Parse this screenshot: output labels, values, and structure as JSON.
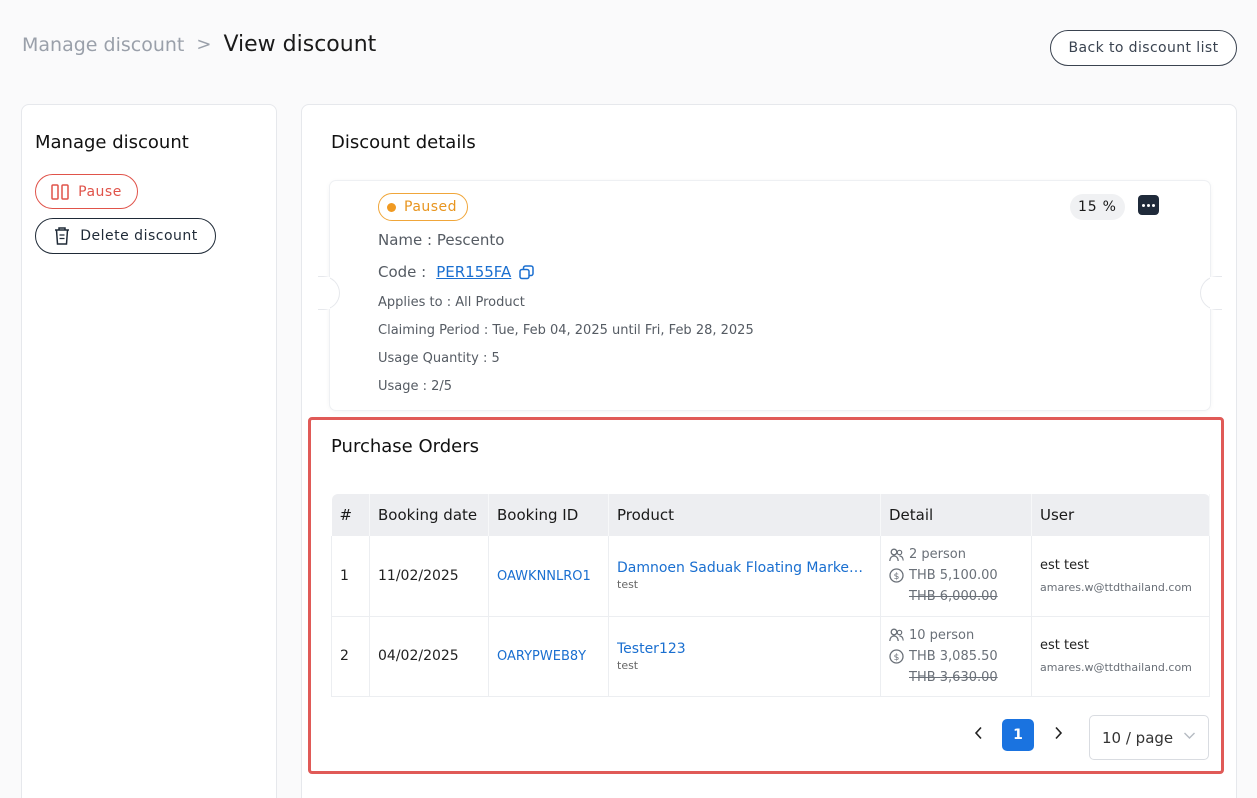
{
  "header": {
    "breadcrumb_parent": "Manage discount",
    "breadcrumb_separator": ">",
    "title": "View discount",
    "back_button": "Back to discount list"
  },
  "sidebar": {
    "title": "Manage discount",
    "pause_label": "Pause",
    "delete_label": "Delete discount"
  },
  "details": {
    "title": "Discount details",
    "status": "Paused",
    "percent": "15 %",
    "name": "Name : Pescento",
    "code_label": "Code :",
    "code_value": "PER155FA",
    "applies_to": "Applies to : All Product",
    "claiming_period": "Claiming Period : Tue, Feb 04, 2025 until Fri, Feb 28, 2025",
    "usage_quantity": "Usage Quantity : 5",
    "usage": "Usage : 2/5"
  },
  "orders": {
    "title": "Purchase Orders",
    "columns": [
      "#",
      "Booking date",
      "Booking ID",
      "Product",
      "Detail",
      "User"
    ],
    "rows": [
      {
        "index": "1",
        "booking_date": "11/02/2025",
        "booking_id": "OAWKNNLRO1",
        "product": "Damnoen Saduak Floating Market &...",
        "product_sub": "test",
        "persons": "2 person",
        "price": "THB 5,100.00",
        "original_price": "THB 6,000.00",
        "user_name": "est test",
        "user_email": "amares.w@ttdthailand.com"
      },
      {
        "index": "2",
        "booking_date": "04/02/2025",
        "booking_id": "OARYPWEB8Y",
        "product": "Tester123",
        "product_sub": "test",
        "persons": "10 person",
        "price": "THB 3,085.50",
        "original_price": "THB 3,630.00",
        "user_name": "est test",
        "user_email": "amares.w@ttdthailand.com"
      }
    ],
    "pagination": {
      "current_page": "1",
      "page_size": "10 / page"
    }
  },
  "colors": {
    "accent_blue": "#1a73e0",
    "danger_red": "#e0534a",
    "paused_orange": "#f09a22",
    "highlight_border": "#e05a57"
  },
  "icons": {
    "pause": "pause-icon",
    "delete": "trash-icon",
    "copy": "copy-icon",
    "more": "more-dots-icon",
    "persons": "users-icon",
    "price": "dollar-coin-icon"
  }
}
